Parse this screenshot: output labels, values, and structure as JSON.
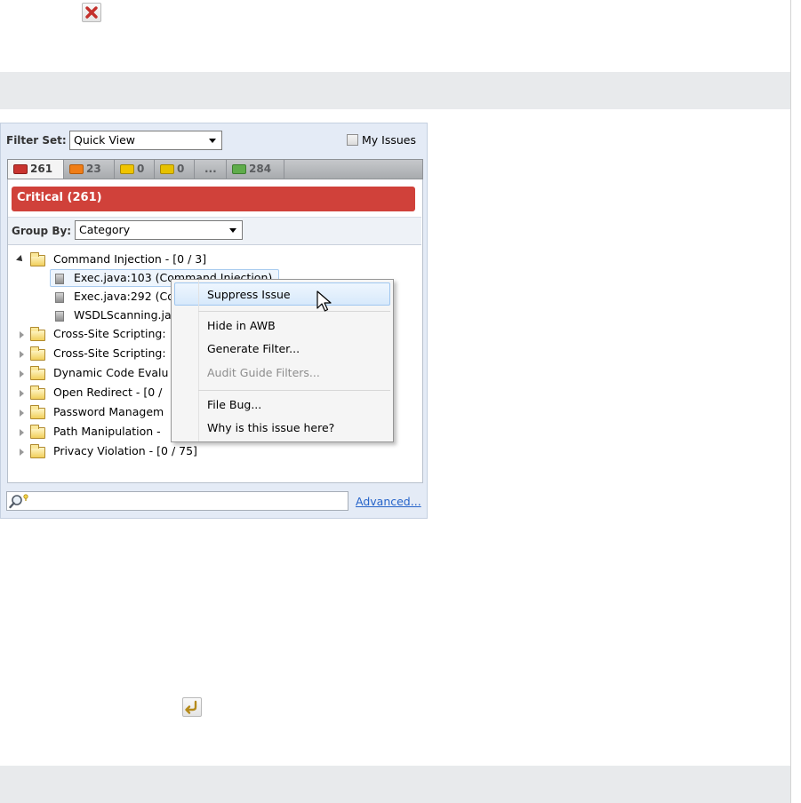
{
  "filter": {
    "label": "Filter Set:",
    "value": "Quick View",
    "my_issues_label": "My Issues"
  },
  "tabs": [
    {
      "count": "261",
      "color": "#c9342f"
    },
    {
      "count": "23",
      "color": "#f07d16"
    },
    {
      "count": "0",
      "color": "#f0c400"
    },
    {
      "count": "0",
      "color": "#e6c100"
    },
    {
      "count": "...",
      "color": ""
    },
    {
      "count": "284",
      "color": "#5fac4b"
    }
  ],
  "critical_banner": "Critical (261)",
  "group_by": {
    "label": "Group By:",
    "value": "Category"
  },
  "tree": {
    "root": "Command Injection - [0 / 3]",
    "children": [
      "Exec.java:103 (Command Injection)",
      "Exec.java:292 (Co",
      "WSDLScanning.ja"
    ],
    "folders": [
      "Cross-Site Scripting:",
      "Cross-Site Scripting:",
      "Dynamic Code Evalu",
      "Open Redirect - [0 /",
      "Password Managem",
      "Path Manipulation -",
      "Privacy Violation - [0 / 75]"
    ]
  },
  "context_menu": {
    "suppress": "Suppress Issue",
    "hide": "Hide in AWB",
    "generate": "Generate Filter...",
    "audit": "Audit Guide Filters...",
    "file_bug": "File Bug...",
    "why": "Why is this issue here?"
  },
  "search": {
    "value": "",
    "advanced_link": "Advanced..."
  },
  "icons": {
    "close": "close-icon",
    "undo": "undo-icon",
    "search": "search-icon"
  }
}
